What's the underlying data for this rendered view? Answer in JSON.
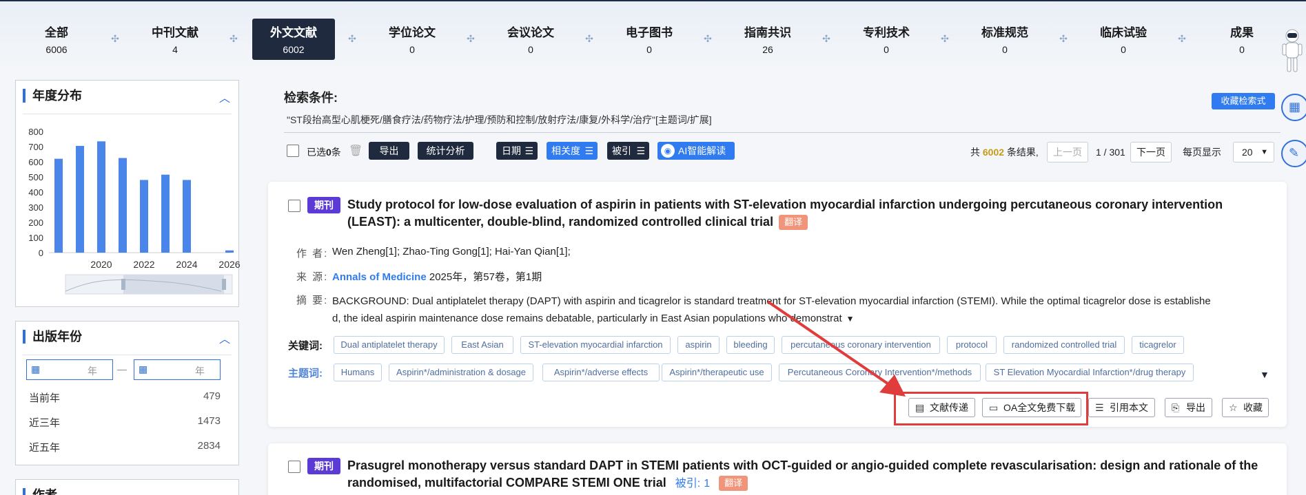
{
  "tabs": [
    {
      "label": "全部",
      "count": "6006"
    },
    {
      "label": "中刊文献",
      "count": "4"
    },
    {
      "label": "外文文献",
      "count": "6002",
      "active": true
    },
    {
      "label": "学位论文",
      "count": "0"
    },
    {
      "label": "会议论文",
      "count": "0"
    },
    {
      "label": "电子图书",
      "count": "0"
    },
    {
      "label": "指南共识",
      "count": "26"
    },
    {
      "label": "专利技术",
      "count": "0"
    },
    {
      "label": "标准规范",
      "count": "0"
    },
    {
      "label": "临床试验",
      "count": "0"
    },
    {
      "label": "成果",
      "count": "0"
    }
  ],
  "sidebar": {
    "year_dist": {
      "title": "年度分布",
      "chart_data": {
        "type": "bar",
        "y_ticks": [
          "800",
          "700",
          "600",
          "500",
          "400",
          "300",
          "200",
          "100",
          "0"
        ],
        "x_ticks": [
          "2020",
          "2022",
          "2024",
          "2026"
        ],
        "ylim": [
          0,
          800
        ],
        "categories": [
          "2018",
          "2019",
          "2020",
          "2021",
          "2022",
          "2023",
          "2024",
          "2025",
          "2026"
        ],
        "values": [
          620,
          705,
          735,
          625,
          480,
          515,
          480,
          0,
          15
        ]
      }
    },
    "pub_year": {
      "title": "出版年份",
      "year_unit": "年",
      "dash": "—",
      "rows": [
        {
          "label": "当前年",
          "count": "479"
        },
        {
          "label": "近三年",
          "count": "1473"
        },
        {
          "label": "近五年",
          "count": "2834"
        }
      ]
    },
    "author_title": "作者"
  },
  "search": {
    "title": "检索条件:",
    "query": "\"ST段抬高型心肌梗死/膳食疗法/药物疗法/护理/预防和控制/放射疗法/康复/外科学/治疗\"[主题词/扩展]",
    "save_label": "收藏检索式"
  },
  "toolbar": {
    "selected_prefix": "已选",
    "selected_count": "0",
    "selected_suffix": "条",
    "export": "导出",
    "stats": "统计分析",
    "date": "日期",
    "relevance": "相关度",
    "cited": "被引",
    "ai": "AI智能解读"
  },
  "pager": {
    "total_prefix": "共",
    "total": "6002",
    "total_suffix": "条结果,",
    "prev": "上一页",
    "page": "1 / 301",
    "next": "下一页",
    "per_page_label": "每页显示",
    "per_page": "20"
  },
  "results": [
    {
      "badge": "期刊",
      "title_line1": "Study protocol for low-dose evaluation of aspirin in patients with ST-elevation myocardial infarction undergoing percutaneous coronary intervention",
      "title_line2": "(LEAST): a multicenter, double-blind, randomized controlled clinical trial",
      "translate": "翻译",
      "author_label": "作 者:",
      "authors": "Wen Zheng[1];  Zhao-Ting Gong[1];  Hai-Yan Qian[1];",
      "source_label": "来 源:",
      "source_journal": "Annals of Medicine",
      "source_detail": " 2025年，第57卷，第1期",
      "abstract_label": "摘 要:",
      "abstract_line1": "BACKGROUND: Dual antiplatelet therapy (DAPT) with aspirin and ticagrelor is standard treatment for ST-elevation myocardial infarction (STEMI). While the optimal ticagrelor dose is establishe",
      "abstract_line2": "d, the ideal aspirin maintenance dose remains debatable, particularly in East Asian populations who demonstrat",
      "keywords_label": "关键词:",
      "keywords": [
        "Dual antiplatelet therapy",
        "East Asian",
        "ST-elevation myocardial infarction",
        "aspirin",
        "bleeding",
        "percutaneous coronary intervention",
        "protocol",
        "randomized controlled trial",
        "ticagrelor"
      ],
      "subjects_label": "主题词:",
      "subjects": [
        "Humans",
        "Aspirin*/administration & dosage",
        "Aspirin*/adverse effects",
        "Aspirin*/therapeutic use",
        "Percutaneous Coronary Intervention*/methods",
        "ST Elevation Myocardial Infarction*/drug therapy"
      ],
      "actions": {
        "deliver": "文献传递",
        "oa": "OA全文免费下载",
        "cite": "引用本文",
        "export": "导出",
        "fav": "收藏"
      }
    },
    {
      "badge": "期刊",
      "title_line1": "Prasugrel monotherapy versus standard DAPT in STEMI patients with OCT-guided or angio-guided complete revascularisation: design and rationale of the",
      "title_line2": "randomised, multifactorial COMPARE STEMI ONE trial",
      "cited_label": "被引:",
      "cited_count": "1",
      "translate": "翻译"
    }
  ],
  "colors": {
    "accent": "#2f7bef",
    "dark": "#1f2a3e",
    "badge": "#5b3ad6",
    "translate": "#f0957a",
    "highlight": "#e13c3c"
  }
}
